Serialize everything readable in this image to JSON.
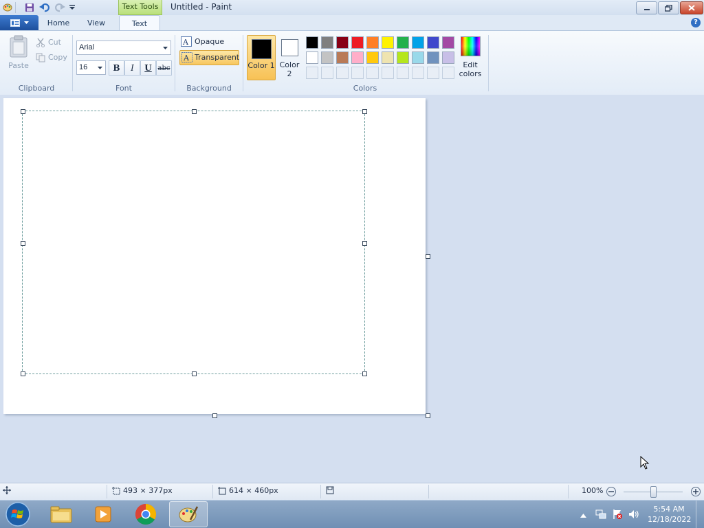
{
  "window": {
    "title": "Untitled - Paint",
    "context_tab": "Text Tools"
  },
  "tabs": [
    "Home",
    "View",
    "Text"
  ],
  "clipboard": {
    "paste": "Paste",
    "cut": "Cut",
    "copy": "Copy",
    "group": "Clipboard"
  },
  "font": {
    "name": "Arial",
    "size": "16",
    "bold": "B",
    "italic": "I",
    "underline": "U",
    "strike": "abc",
    "group": "Font"
  },
  "background": {
    "opaque": "Opaque",
    "transparent": "Transparent",
    "group": "Background"
  },
  "colors": {
    "color1": "Color 1",
    "color2": "Color 2",
    "edit": "Edit colors",
    "group": "Colors",
    "color1_value": "#000000",
    "color2_value": "#ffffff",
    "palette_row1": [
      "#000000",
      "#7f7f7f",
      "#880015",
      "#ed1c24",
      "#ff7f27",
      "#fff200",
      "#22b14c",
      "#00a2e8",
      "#3f48cc",
      "#a349a4"
    ],
    "palette_row2": [
      "#ffffff",
      "#c3c3c3",
      "#b97a57",
      "#ffaec9",
      "#ffc90e",
      "#efe4b0",
      "#b5e61d",
      "#99d9ea",
      "#7092be",
      "#c8bfe7"
    ]
  },
  "status": {
    "selection_size": "493 × 377px",
    "canvas_size": "614 × 460px",
    "zoom": "100%",
    "zoom_fraction": 0.5
  },
  "taskbar": {
    "time": "5:54 AM",
    "date": "12/18/2022"
  }
}
